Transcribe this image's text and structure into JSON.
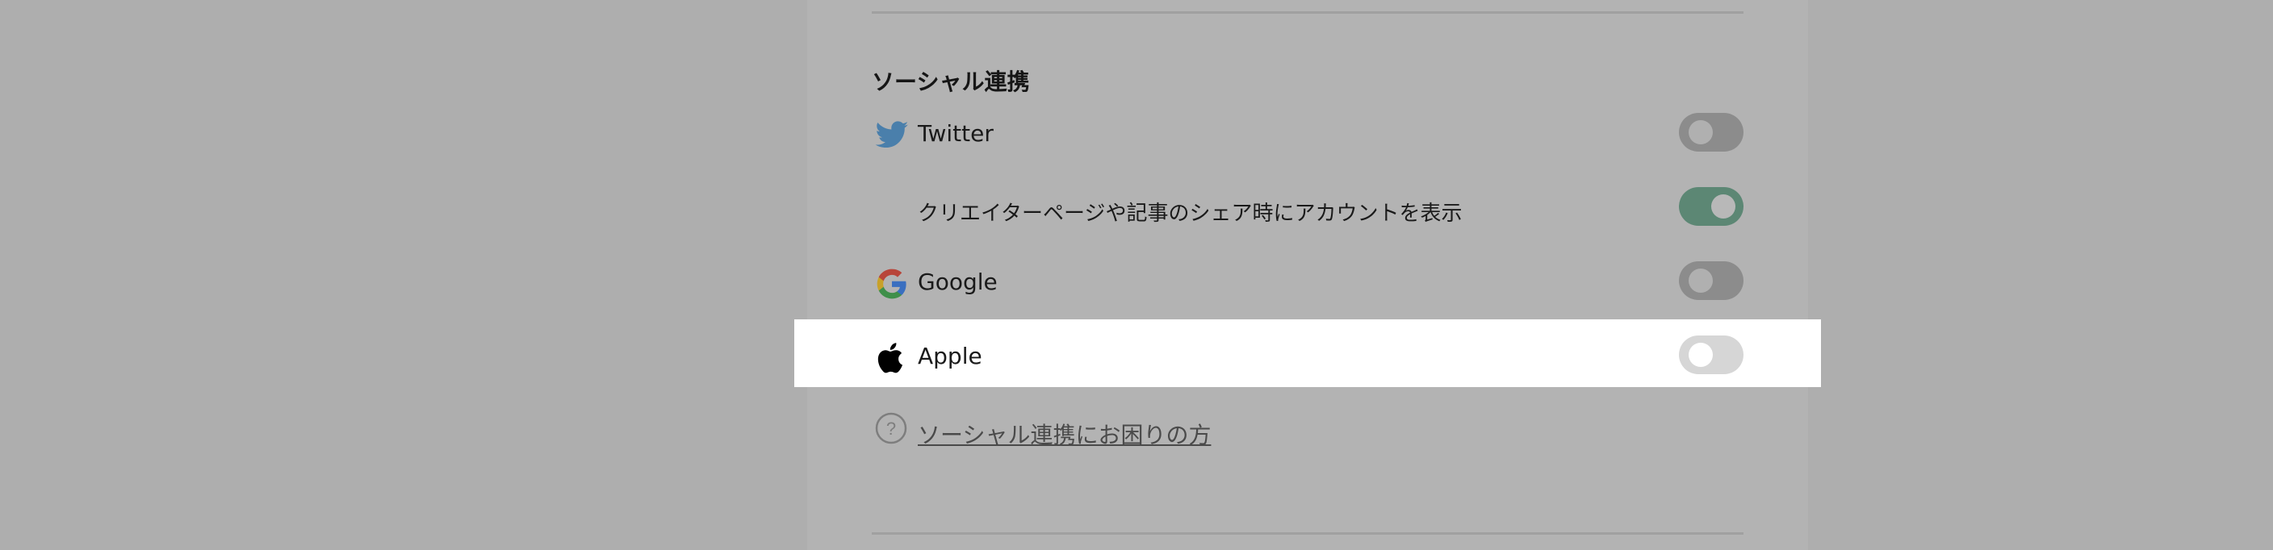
{
  "social": {
    "title": "ソーシャル連携",
    "twitter": {
      "label": "Twitter",
      "icon": "twitter-icon",
      "enabled": false
    },
    "twitter_share": {
      "label": "クリエイターページや記事のシェア時にアカウントを表示",
      "enabled": true
    },
    "google": {
      "label": "Google",
      "icon": "google-icon",
      "enabled": false
    },
    "apple": {
      "label": "Apple",
      "icon": "apple-icon",
      "enabled": false
    },
    "help_link": "ソーシャル連携にお困りの方"
  },
  "colors": {
    "toggle_on": "#5c8774",
    "toggle_off": "#8c8c8c",
    "twitter": "#4a7fab"
  }
}
